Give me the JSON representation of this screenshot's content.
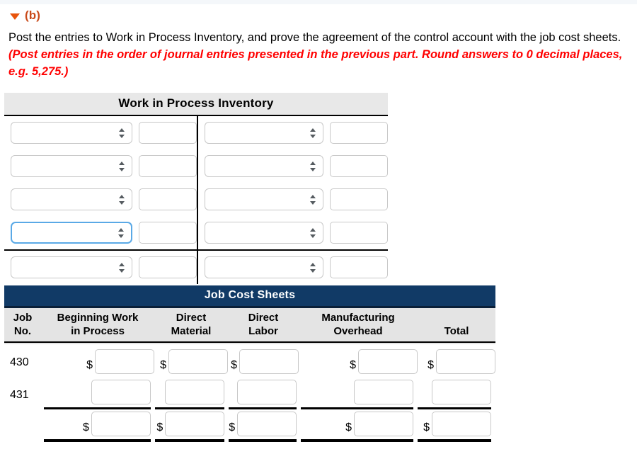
{
  "part": {
    "toggle_icon": "triangle-down-icon",
    "label": "(b)"
  },
  "instructions": {
    "normal_1": "Post the entries to Work in Process Inventory, and prove the agreement of the control account with the job cost sheets.",
    "emphasis": "(Post entries in the order of journal entries presented in the previous part. Round answers to 0 decimal places, e.g. 5,275.)"
  },
  "wip_table": {
    "title": "Work in Process Inventory",
    "select_placeholder": "",
    "amount_placeholder": "",
    "rows": [
      {
        "left_select": "",
        "left_amount": "",
        "right_select": "",
        "right_amount": "",
        "focused": false,
        "ruled_below": false
      },
      {
        "left_select": "",
        "left_amount": "",
        "right_select": "",
        "right_amount": "",
        "focused": false,
        "ruled_below": false
      },
      {
        "left_select": "",
        "left_amount": "",
        "right_select": "",
        "right_amount": "",
        "focused": false,
        "ruled_below": false
      },
      {
        "left_select": "",
        "left_amount": "",
        "right_select": "",
        "right_amount": "",
        "focused": true,
        "ruled_below": true
      },
      {
        "left_select": "",
        "left_amount": "",
        "right_select": "",
        "right_amount": "",
        "focused": false,
        "ruled_below": false
      }
    ]
  },
  "jcs_table": {
    "title": "Job Cost Sheets",
    "columns": [
      {
        "key": "job_no",
        "line1": "Job",
        "line2": "No."
      },
      {
        "key": "bwip",
        "line1": "Beginning Work",
        "line2": "in Process"
      },
      {
        "key": "dm",
        "line1": "Direct",
        "line2": "Material"
      },
      {
        "key": "dl",
        "line1": "Direct",
        "line2": "Labor"
      },
      {
        "key": "moh",
        "line1": "Manufacturing",
        "line2": "Overhead"
      },
      {
        "key": "total",
        "line1": "",
        "line2": "Total"
      }
    ],
    "currency_symbol": "$",
    "input_placeholder": "",
    "rows": [
      {
        "job_no": "430",
        "show_currency": true,
        "rule": "none",
        "values": {
          "bwip": "",
          "dm": "",
          "dl": "",
          "moh": "",
          "total": ""
        }
      },
      {
        "job_no": "431",
        "show_currency": false,
        "rule": "subtotal",
        "values": {
          "bwip": "",
          "dm": "",
          "dl": "",
          "moh": "",
          "total": ""
        }
      },
      {
        "job_no": "",
        "show_currency": true,
        "rule": "total",
        "values": {
          "bwip": "",
          "dm": "",
          "dl": "",
          "moh": "",
          "total": ""
        }
      }
    ]
  },
  "colors": {
    "accent_orange": "#c94a1a",
    "toggle_orange": "#e8540c",
    "emphasis_red": "#ff0000",
    "wip_header_bg": "#e8e8e8",
    "jcs_header_bg": "#113A66",
    "jcs_subhead_bg": "#e4e4e4",
    "focus_blue": "#5aa9e6",
    "field_border": "#c8c8c8"
  }
}
